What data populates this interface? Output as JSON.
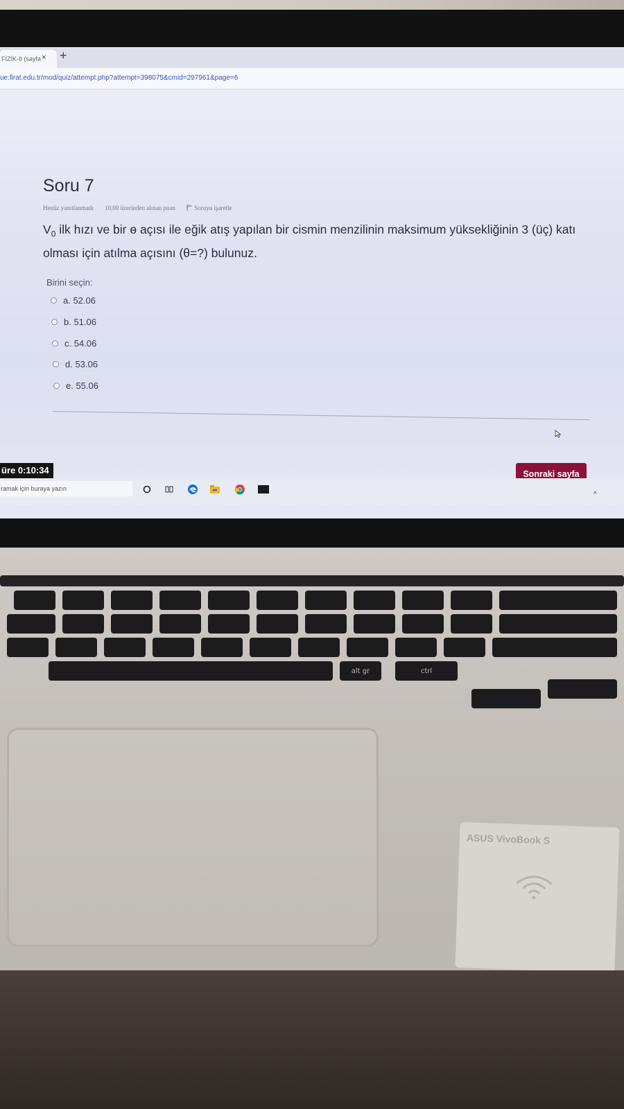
{
  "browser": {
    "tab_title": "FİZİK-II (sayfa",
    "tab_close": "×",
    "new_tab": "+",
    "url": "ue.firat.edu.tr/mod/quiz/attempt.php?attempt=398075&cmid=297961&page=6"
  },
  "question": {
    "title": "Soru 7",
    "status": "Henüz yanıtlanmadı",
    "points": "10,00 üzerinden alınan puan",
    "flag_label": "Soruyu işaretle",
    "text_v": "V",
    "text_sub": "0",
    "text_rest": " ilk hızı ve bir ɵ açısı ile eğik atış yapılan bir cismin menzilinin maksimum yüksekliğinin 3 (üç) katı olması için atılma açısını (θ=?) bulunuz.",
    "prompt": "Birini seçin:",
    "options": [
      {
        "label": "a. 52.06"
      },
      {
        "label": "b. 51.06"
      },
      {
        "label": "c. 54.06"
      },
      {
        "label": "d. 53.06"
      },
      {
        "label": "e. 55.06"
      }
    ]
  },
  "timer": "üre 0:10:34",
  "next_button": "Sonraki sayfa",
  "taskbar": {
    "search_placeholder": "ramak için buraya yazın"
  },
  "keyboard_labels": {
    "alt_gr": "alt gr",
    "ctrl": "ctrl"
  },
  "sticker_brand": "ASUS VivoBook S",
  "colors": {
    "accent_button": "#8c1238",
    "link": "#3b55b0",
    "timer_bg": "#141414"
  }
}
